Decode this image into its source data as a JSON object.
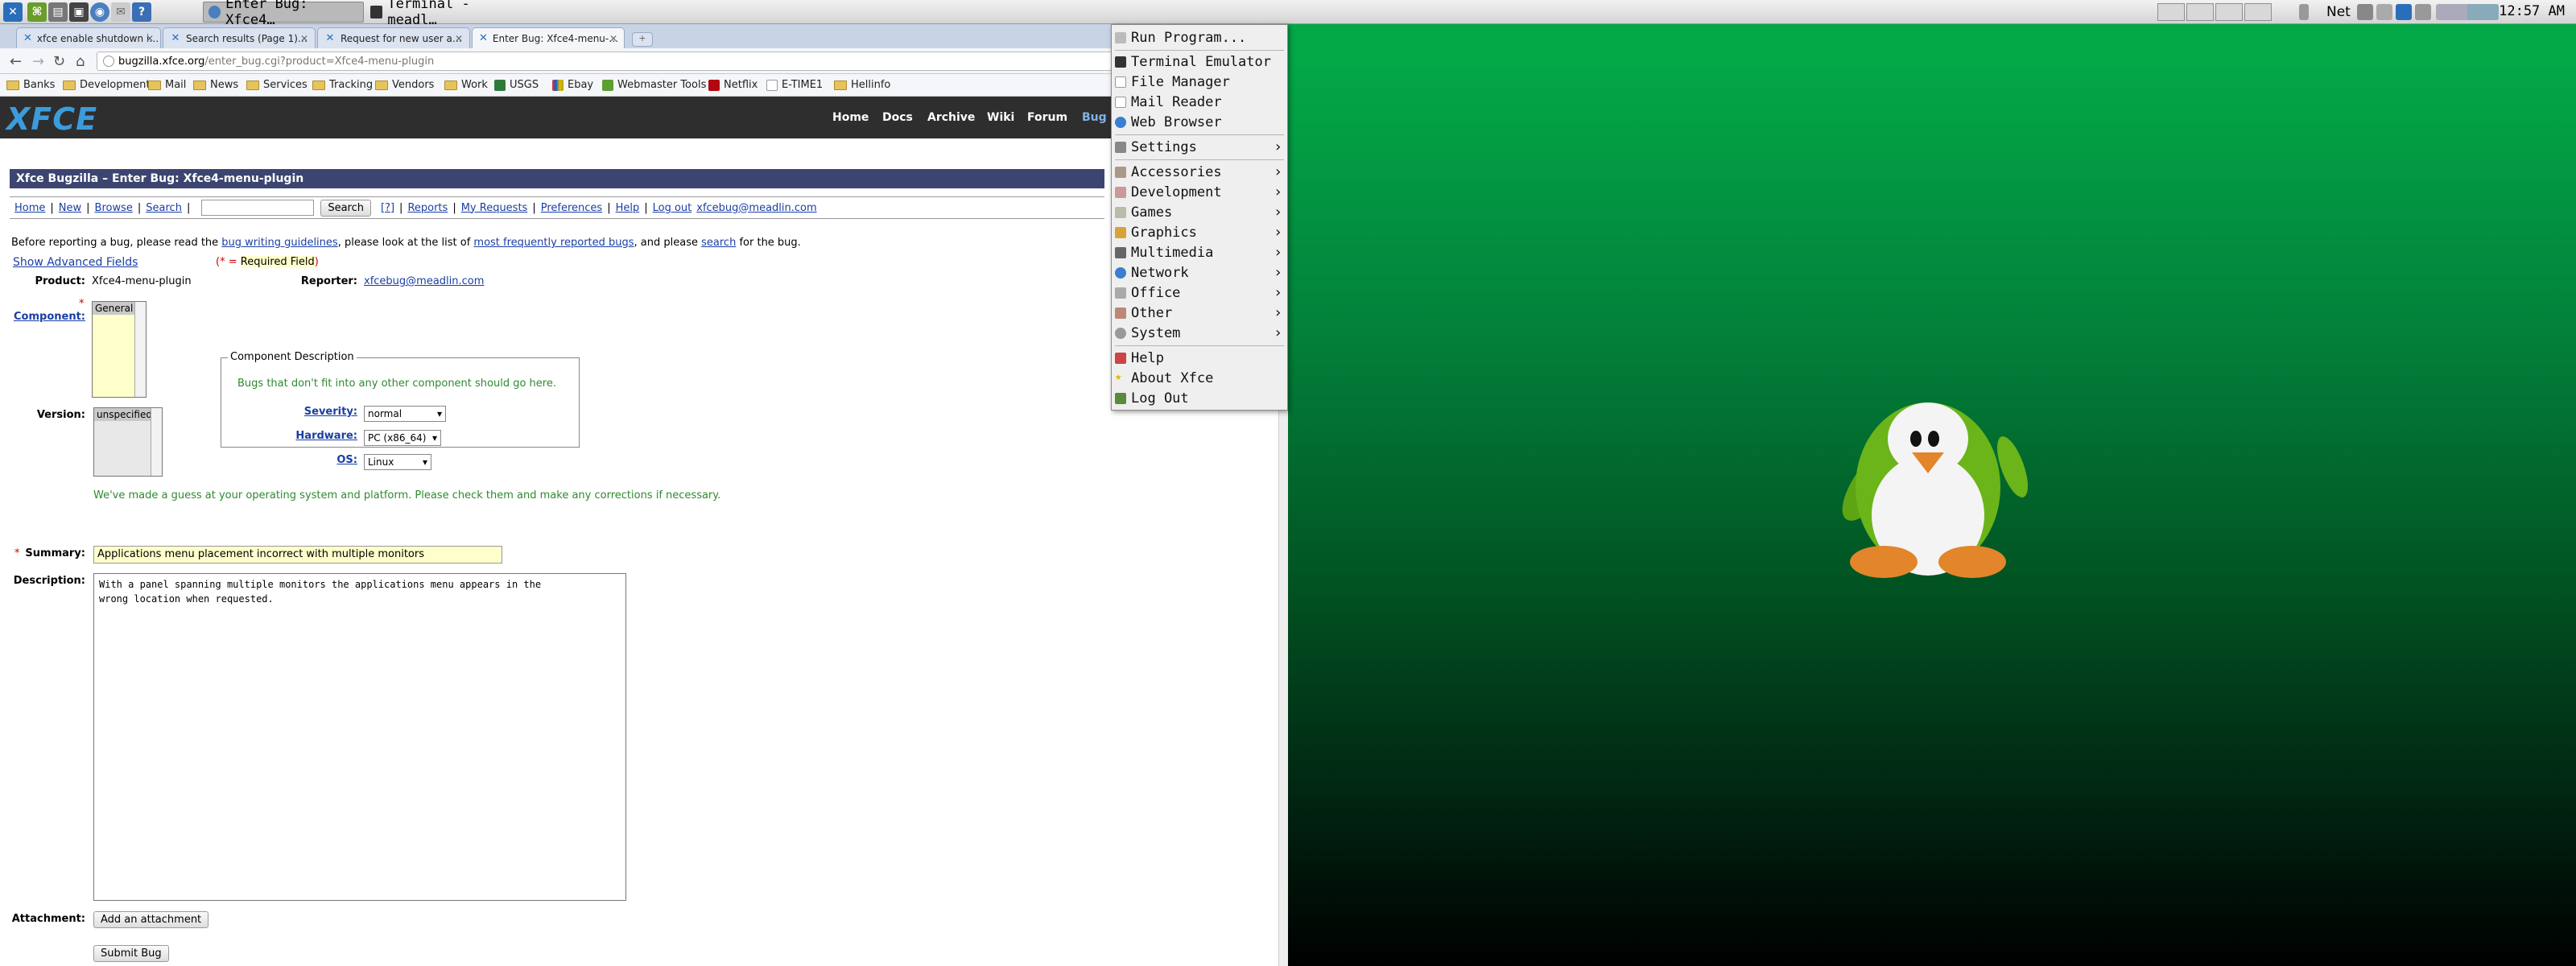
{
  "panel": {
    "tasks": [
      {
        "label": "Enter Bug: Xfce4…",
        "active": true
      },
      {
        "label": "Terminal - meadl…",
        "active": false
      }
    ],
    "net_label": "Net",
    "clock": "12:57 AM"
  },
  "browser": {
    "tabs": [
      {
        "label": "xfce enable shutdown i…",
        "active": false
      },
      {
        "label": "Search results (Page 1)…",
        "active": false
      },
      {
        "label": "Request for new user a…",
        "active": false
      },
      {
        "label": "Enter Bug: Xfce4-menu-…",
        "active": true
      }
    ],
    "url_host": "bugzilla.xfce.org",
    "url_path": "/enter_bug.cgi?product=Xfce4-menu-plugin",
    "bookmarks": [
      {
        "label": "Banks",
        "type": "folder"
      },
      {
        "label": "Development",
        "type": "folder"
      },
      {
        "label": "Mail",
        "type": "folder"
      },
      {
        "label": "News",
        "type": "folder"
      },
      {
        "label": "Services",
        "type": "folder"
      },
      {
        "label": "Tracking",
        "type": "folder"
      },
      {
        "label": "Vendors",
        "type": "folder"
      },
      {
        "label": "Work",
        "type": "folder"
      },
      {
        "label": "USGS",
        "type": "site"
      },
      {
        "label": "Ebay",
        "type": "site"
      },
      {
        "label": "Webmaster Tools",
        "type": "site"
      },
      {
        "label": "Netflix",
        "type": "site"
      },
      {
        "label": "E-TIME1",
        "type": "site"
      },
      {
        "label": "Hellinfo",
        "type": "folder"
      }
    ]
  },
  "site": {
    "logo": "XFCE",
    "nav": [
      "Home",
      "Docs",
      "Archive",
      "Wiki",
      "Forum",
      "Bug"
    ]
  },
  "bugzilla": {
    "title": "Xfce Bugzilla – Enter Bug: Xfce4-menu-plugin",
    "links": {
      "home": "Home",
      "new": "New",
      "browse": "Browse",
      "search": "Search",
      "search_button": "Search",
      "help_q": "[?]",
      "reports": "Reports",
      "my_requests": "My Requests",
      "preferences": "Preferences",
      "help": "Help",
      "logout": "Log out",
      "user": "xfcebug@meadlin.com"
    },
    "intro": {
      "p1": "Before reporting a bug, please read the ",
      "l1": "bug writing guidelines",
      "p2": ", please look at the list of ",
      "l2": "most frequently reported bugs",
      "p3": ", and please ",
      "l3": "search",
      "p4": " for the bug."
    },
    "show_advanced": "Show Advanced Fields",
    "required_note_pre": "(",
    "required_star": "*",
    "required_note_mid": " = ",
    "required_note_text": "Required Field",
    "required_note_post": ")",
    "product_label": "Product:",
    "product_value": "Xfce4-menu-plugin",
    "reporter_label": "Reporter:",
    "reporter_value": "xfcebug@meadlin.com",
    "component_label": "Component:",
    "component_selected": "General",
    "component_desc_legend": "Component Description",
    "component_desc_text": "Bugs that don't fit into any other component should go here.",
    "version_label": "Version:",
    "version_selected": "unspecified",
    "severity_label": "Severity:",
    "severity_value": "normal",
    "hardware_label": "Hardware:",
    "hardware_value": "PC (x86_64)",
    "os_label": "OS:",
    "os_value": "Linux",
    "guess_note": "We've made a guess at your operating system and platform. Please check them and make any corrections if necessary.",
    "summary_label": "Summary:",
    "summary_value": "Applications menu placement incorrect with multiple monitors",
    "description_label": "Description:",
    "description_value": "With a panel spanning multiple monitors the applications menu appears in the\nwrong location when requested.",
    "attachment_label": "Attachment:",
    "add_attachment": "Add an attachment",
    "submit": "Submit Bug"
  },
  "menu": {
    "items": [
      {
        "label": "Run Program...",
        "icon": "run-icon"
      },
      {
        "label": "Terminal Emulator",
        "icon": "terminal-icon"
      },
      {
        "label": "File Manager",
        "icon": "file-manager-icon"
      },
      {
        "label": "Mail Reader",
        "icon": "mail-icon"
      },
      {
        "label": "Web Browser",
        "icon": "globe-icon"
      },
      {
        "label": "Settings",
        "icon": "settings-icon",
        "submenu": true
      },
      {
        "label": "Accessories",
        "icon": "accessories-icon",
        "submenu": true
      },
      {
        "label": "Development",
        "icon": "development-icon",
        "submenu": true
      },
      {
        "label": "Games",
        "icon": "games-icon",
        "submenu": true
      },
      {
        "label": "Graphics",
        "icon": "graphics-icon",
        "submenu": true
      },
      {
        "label": "Multimedia",
        "icon": "multimedia-icon",
        "submenu": true
      },
      {
        "label": "Network",
        "icon": "network-icon",
        "submenu": true
      },
      {
        "label": "Office",
        "icon": "office-icon",
        "submenu": true
      },
      {
        "label": "Other",
        "icon": "other-icon",
        "submenu": true
      },
      {
        "label": "System",
        "icon": "system-icon",
        "submenu": true
      },
      {
        "label": "Help",
        "icon": "help-icon"
      },
      {
        "label": "About Xfce",
        "icon": "star-icon"
      },
      {
        "label": "Log Out",
        "icon": "logout-icon"
      }
    ],
    "arrow": "›"
  },
  "colors": {
    "desktop_green": "#03a847",
    "bugzilla_title_bg": "#3b4570",
    "link": "#1a3fa4",
    "note_green": "#2e8a2e"
  }
}
